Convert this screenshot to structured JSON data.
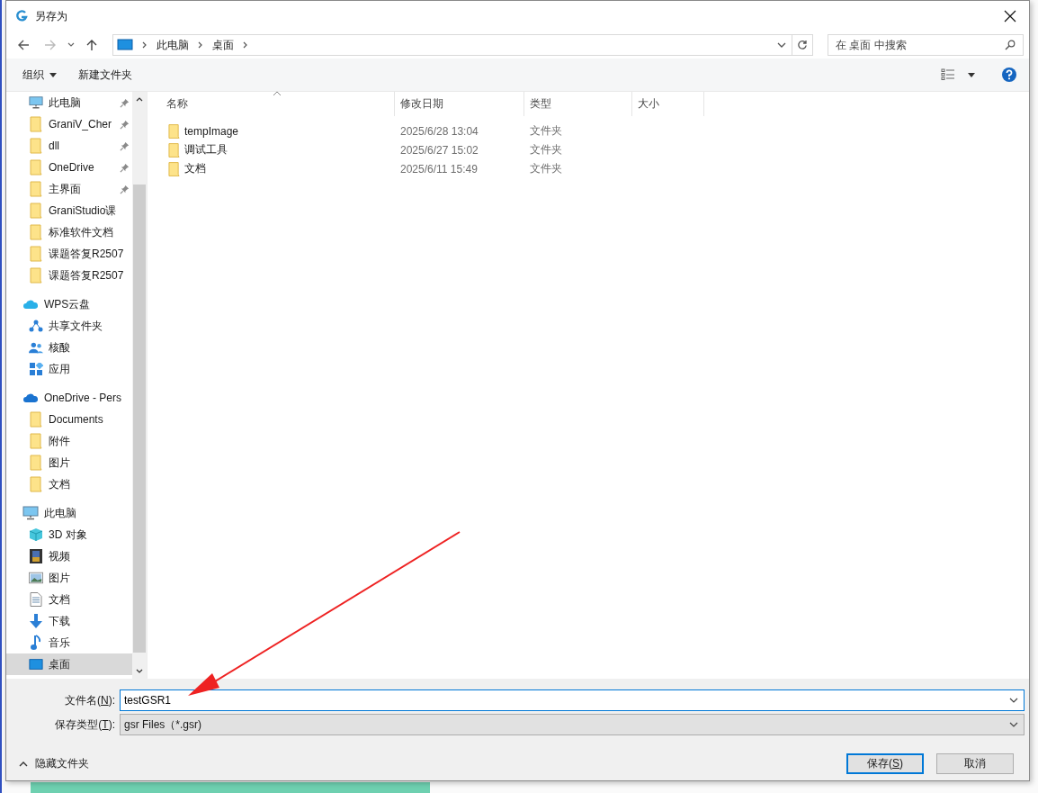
{
  "window": {
    "title": "另存为"
  },
  "nav": {
    "breadcrumb": [
      "此电脑",
      "桌面"
    ],
    "search": {
      "placeholder": "在 桌面 中搜索"
    }
  },
  "toolbar": {
    "organize": "组织",
    "new_folder": "新建文件夹"
  },
  "sidebar": {
    "groups": [
      {
        "children": [
          {
            "label": "此电脑",
            "kind": "monitor",
            "pinned": true,
            "selected": false
          },
          {
            "label": "GraniV_Cher",
            "kind": "folder",
            "pinned": true,
            "selected": false
          },
          {
            "label": "dll",
            "kind": "folder",
            "pinned": true,
            "selected": false
          },
          {
            "label": "OneDrive",
            "kind": "folder",
            "pinned": true,
            "selected": false
          },
          {
            "label": "主界面",
            "kind": "folder",
            "pinned": true,
            "selected": false
          },
          {
            "label": "GraniStudio课",
            "kind": "folder",
            "pinned": false,
            "selected": false
          },
          {
            "label": "标准软件文档",
            "kind": "folder",
            "pinned": false,
            "selected": false
          },
          {
            "label": "课题答复R2507",
            "kind": "folder",
            "pinned": false,
            "selected": false
          },
          {
            "label": "课题答复R2507",
            "kind": "folder",
            "pinned": false,
            "selected": false
          }
        ]
      },
      {
        "label": "WPS云盘",
        "kind": "cloud",
        "children": [
          {
            "label": "共享文件夹",
            "kind": "share",
            "pinned": false,
            "selected": false
          },
          {
            "label": "核酸",
            "kind": "people",
            "pinned": false,
            "selected": false
          },
          {
            "label": "应用",
            "kind": "apps",
            "pinned": false,
            "selected": false
          }
        ]
      },
      {
        "label": "OneDrive - Pers",
        "kind": "onedrive",
        "children": [
          {
            "label": "Documents",
            "kind": "folder",
            "pinned": false,
            "selected": false
          },
          {
            "label": "附件",
            "kind": "folder",
            "pinned": false,
            "selected": false
          },
          {
            "label": "图片",
            "kind": "folder",
            "pinned": false,
            "selected": false
          },
          {
            "label": "文档",
            "kind": "folder",
            "pinned": false,
            "selected": false
          }
        ]
      },
      {
        "label": "此电脑",
        "kind": "monitor",
        "children": [
          {
            "label": "3D 对象",
            "kind": "cube",
            "pinned": false,
            "selected": false
          },
          {
            "label": "视频",
            "kind": "film",
            "pinned": false,
            "selected": false
          },
          {
            "label": "图片",
            "kind": "picture",
            "pinned": false,
            "selected": false
          },
          {
            "label": "文档",
            "kind": "doc",
            "pinned": false,
            "selected": false
          },
          {
            "label": "下载",
            "kind": "download",
            "pinned": false,
            "selected": false
          },
          {
            "label": "音乐",
            "kind": "music",
            "pinned": false,
            "selected": false
          },
          {
            "label": "桌面",
            "kind": "desktop",
            "pinned": false,
            "selected": true
          }
        ]
      }
    ]
  },
  "table": {
    "columns": [
      "名称",
      "修改日期",
      "类型",
      "大小"
    ],
    "rows": [
      {
        "name": "tempImage",
        "date": "2025/6/28 13:04",
        "type": "文件夹"
      },
      {
        "name": "调试工具",
        "date": "2025/6/27 15:02",
        "type": "文件夹"
      },
      {
        "name": "文档",
        "date": "2025/6/11 15:49",
        "type": "文件夹"
      }
    ]
  },
  "form": {
    "filename": {
      "label_parts": [
        "文件名(",
        "N",
        "):"
      ],
      "value": "testGSR1"
    },
    "filetype": {
      "label_parts": [
        "保存类型(",
        "T",
        "):"
      ],
      "value": "gsr Files（*.gsr)"
    }
  },
  "footer": {
    "hide_folders": "隐藏文件夹",
    "save_parts": [
      "保存(",
      "S",
      ")"
    ],
    "cancel": "取消"
  }
}
